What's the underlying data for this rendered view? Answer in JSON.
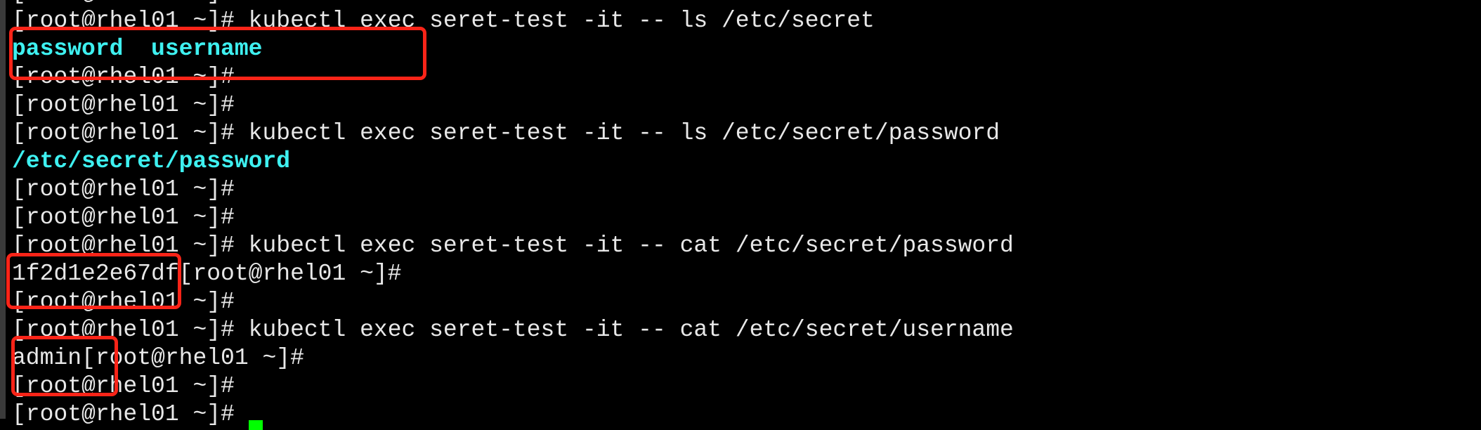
{
  "terminal": {
    "colors": {
      "background": "#000000",
      "text": "#e8e8e8",
      "listing": "#3ef0f0",
      "cursor": "#00ff00",
      "highlight_box": "#fa2418"
    },
    "lines": [
      {
        "prompt": "[root@rhel01 ~]#",
        "text": "",
        "cyan": ""
      },
      {
        "prompt": "[root@rhel01 ~]#",
        "text": " kubectl exec seret-test -it -- ls /etc/secret",
        "cyan": ""
      },
      {
        "prompt": "",
        "text": "",
        "cyan": "password  username"
      },
      {
        "prompt": "[root@rhel01 ~]#",
        "text": "",
        "cyan": ""
      },
      {
        "prompt": "[root@rhel01 ~]#",
        "text": "",
        "cyan": ""
      },
      {
        "prompt": "[root@rhel01 ~]#",
        "text": " kubectl exec seret-test -it -- ls /etc/secret/password",
        "cyan": ""
      },
      {
        "prompt": "",
        "text": "",
        "cyan": "/etc/secret/password"
      },
      {
        "prompt": "[root@rhel01 ~]#",
        "text": "",
        "cyan": ""
      },
      {
        "prompt": "[root@rhel01 ~]#",
        "text": "",
        "cyan": ""
      },
      {
        "prompt": "[root@rhel01 ~]#",
        "text": " kubectl exec seret-test -it -- cat /etc/secret/password",
        "cyan": ""
      },
      {
        "prompt": "1f2d1e2e67df[root@rhel01 ~]#",
        "text": "",
        "cyan": ""
      },
      {
        "prompt": "[root@rhel01 ~]#",
        "text": "",
        "cyan": ""
      },
      {
        "prompt": "[root@rhel01 ~]#",
        "text": " kubectl exec seret-test -it -- cat /etc/secret/username",
        "cyan": ""
      },
      {
        "prompt": "admin[root@rhel01 ~]#",
        "text": "",
        "cyan": ""
      },
      {
        "prompt": "[root@rhel01 ~]#",
        "text": "",
        "cyan": ""
      },
      {
        "prompt": "[root@rhel01 ~]# ",
        "text": "",
        "cyan": ""
      }
    ]
  }
}
